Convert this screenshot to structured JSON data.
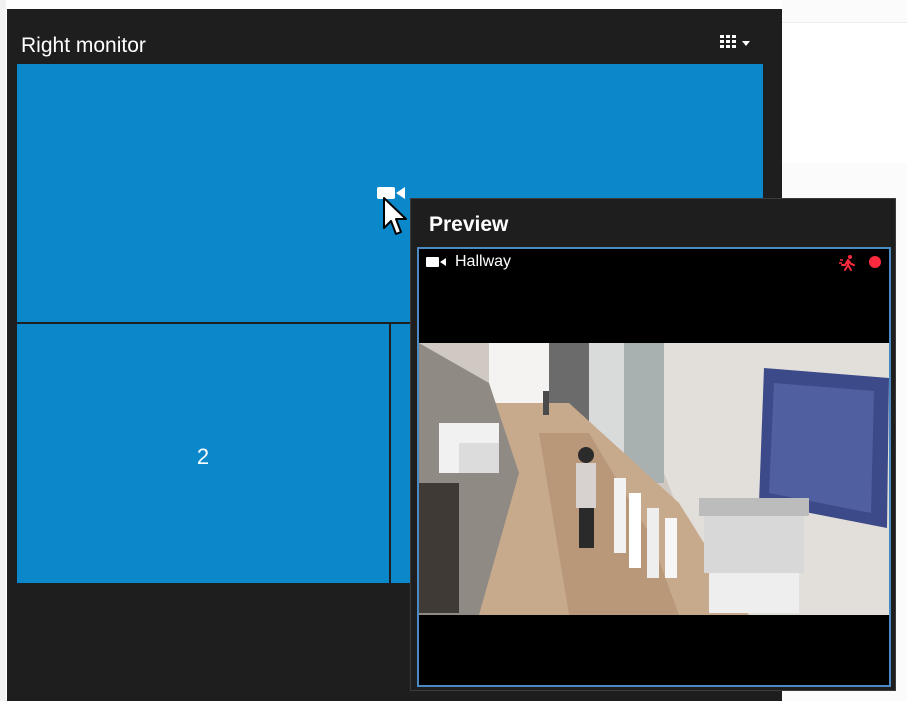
{
  "monitor": {
    "title": "Right monitor",
    "layout_icon": "grid-icon",
    "layout_menu_icon": "chevron-down-icon"
  },
  "view": {
    "tiles": [
      {
        "number": "",
        "color": "#0b88ca"
      },
      {
        "number": "2",
        "color": "#0b88ca"
      },
      {
        "number": "",
        "color": "#0b88ca"
      }
    ]
  },
  "drag": {
    "camera_icon": "camera-icon",
    "cursor_icon": "pointer-cursor-icon"
  },
  "preview": {
    "title": "Preview",
    "camera_name": "Hallway",
    "camera_icon": "camera-icon",
    "motion_indicator_icon": "motion-icon",
    "recording_indicator_icon": "recording-dot-icon",
    "recording_color": "#ff2a3d"
  }
}
